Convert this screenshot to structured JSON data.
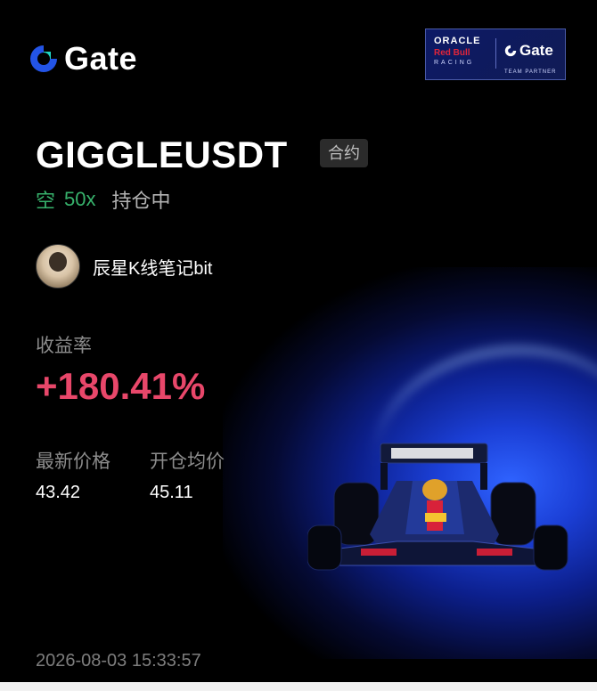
{
  "brand": {
    "logo_text": "Gate",
    "accent": "#2354e6"
  },
  "partner_badge": {
    "oracle": "ORACLE",
    "redbull": "Red Bull",
    "racing": "RACING",
    "gate": "Gate",
    "team_partner": "TEAM PARTNER"
  },
  "position": {
    "symbol": "GIGGLEUSDT",
    "type_badge": "合约",
    "side": "空",
    "leverage": "50x",
    "status": "持仓中"
  },
  "user": {
    "name": "辰星K线笔记bit"
  },
  "stats": {
    "roi_label": "收益率",
    "roi_value": "+180.41%",
    "latest_price_label": "最新价格",
    "latest_price": "43.42",
    "entry_price_label": "开仓均价",
    "entry_price": "45.11"
  },
  "timestamp": "2026-08-03 15:33:57",
  "colors": {
    "short_green": "#37b26c",
    "roi_red": "#e8476a",
    "muted": "#8c8c8c"
  }
}
